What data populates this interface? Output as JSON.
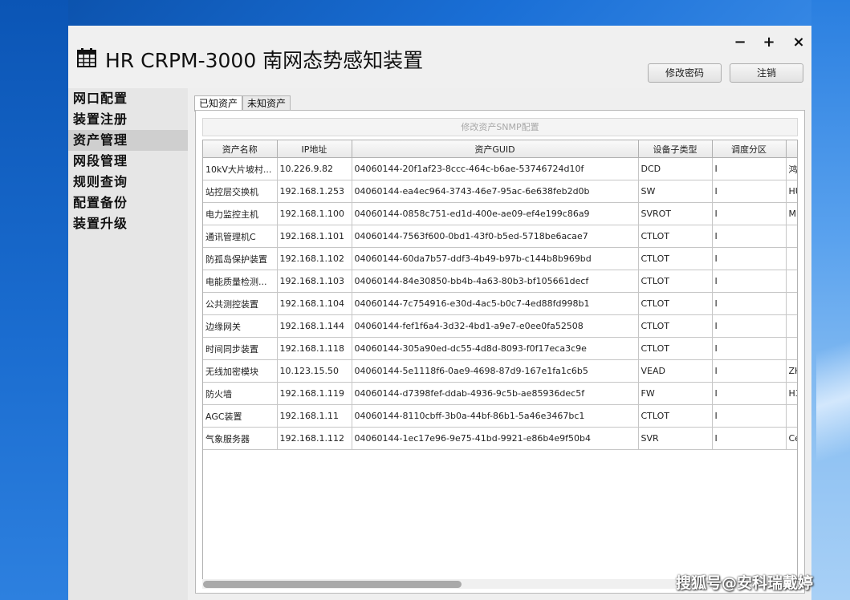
{
  "window": {
    "title": "HR CRPM-3000 南网态势感知装置",
    "minimize_label": "−",
    "maximize_label": "+",
    "close_label": "×",
    "change_password_label": "修改密码",
    "logout_label": "注销"
  },
  "sidebar": {
    "items": [
      {
        "label": "网口配置"
      },
      {
        "label": "装置注册"
      },
      {
        "label": "资产管理"
      },
      {
        "label": "网段管理"
      },
      {
        "label": "规则查询"
      },
      {
        "label": "配置备份"
      },
      {
        "label": "装置升级"
      }
    ],
    "active_index": 2
  },
  "tabs": [
    {
      "label": "已知资产"
    },
    {
      "label": "未知资产"
    }
  ],
  "snmp_button_label": "修改资产SNMP配置",
  "table": {
    "columns": [
      "资产名称",
      "IP地址",
      "资产GUID",
      "设备子类型",
      "调度分区",
      ""
    ],
    "rows": [
      [
        "10kV大片坡村...",
        "10.226.9.82",
        "04060144-20f1af23-8ccc-464c-b6ae-53746724d10f",
        "DCD",
        "I",
        "鸿"
      ],
      [
        "站控层交换机",
        "192.168.1.253",
        "04060144-ea4ec964-3743-46e7-95ac-6e638feb2d0b",
        "SW",
        "I",
        "HU"
      ],
      [
        "电力监控主机",
        "192.168.1.100",
        "04060144-0858c751-ed1d-400e-ae09-ef4e199c86a9",
        "SVROT",
        "I",
        "M"
      ],
      [
        "通讯管理机C",
        "192.168.1.101",
        "04060144-7563f600-0bd1-43f0-b5ed-5718be6acae7",
        "CTLOT",
        "I",
        ""
      ],
      [
        "防孤岛保护装置",
        "192.168.1.102",
        "04060144-60da7b57-ddf3-4b49-b97b-c144b8b969bd",
        "CTLOT",
        "I",
        ""
      ],
      [
        "电能质量检测...",
        "192.168.1.103",
        "04060144-84e30850-bb4b-4a63-80b3-bf105661decf",
        "CTLOT",
        "I",
        ""
      ],
      [
        "公共测控装置",
        "192.168.1.104",
        "04060144-7c754916-e30d-4ac5-b0c7-4ed88fd998b1",
        "CTLOT",
        "I",
        ""
      ],
      [
        "边缘网关",
        "192.168.1.144",
        "04060144-fef1f6a4-3d32-4bd1-a9e7-e0ee0fa52508",
        "CTLOT",
        "I",
        ""
      ],
      [
        "时间同步装置",
        "192.168.1.118",
        "04060144-305a90ed-dc55-4d8d-8093-f0f17eca3c9e",
        "CTLOT",
        "I",
        ""
      ],
      [
        "无线加密模块",
        "10.123.15.50",
        "04060144-5e1118f6-0ae9-4698-87d9-167e1fa1c6b5",
        "VEAD",
        "I",
        "ZH"
      ],
      [
        "防火墙",
        "192.168.1.119",
        "04060144-d7398fef-ddab-4936-9c5b-ae85936dec5f",
        "FW",
        "I",
        "H3"
      ],
      [
        "AGC装置",
        "192.168.1.11",
        "04060144-8110cbff-3b0a-44bf-86b1-5a46e3467bc1",
        "CTLOT",
        "I",
        ""
      ],
      [
        "气象服务器",
        "192.168.1.112",
        "04060144-1ec17e96-9e75-41bd-9921-e86b4e9f50b4",
        "SVR",
        "I",
        "Ce"
      ]
    ]
  },
  "watermark": "搜狐号@安科瑞戴婷",
  "icons": {
    "app": "calendar-icon"
  }
}
